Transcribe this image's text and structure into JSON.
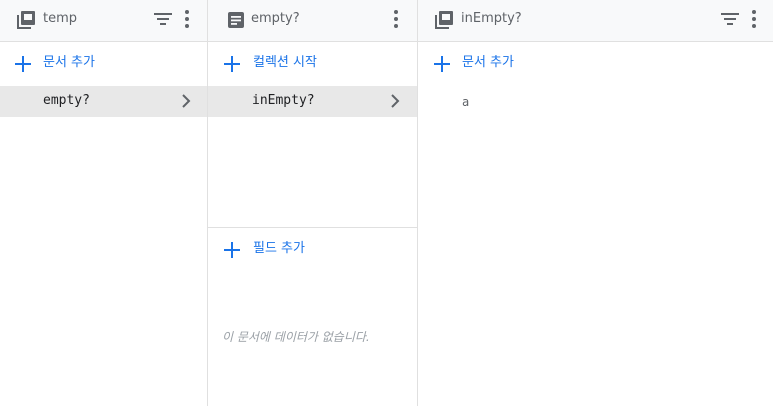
{
  "panels": [
    {
      "header": {
        "title": "temp",
        "icon": "collection-icon"
      },
      "add_label": "문서 추가",
      "items": [
        {
          "label": "empty?"
        }
      ]
    },
    {
      "header": {
        "title": "empty?",
        "icon": "document-icon"
      },
      "add_label": "컬렉션 시작",
      "items": [
        {
          "label": "inEmpty?"
        }
      ],
      "add_field_label": "필드 추가",
      "empty_message": "이 문서에 데이터가 없습니다."
    },
    {
      "header": {
        "title": "inEmpty?",
        "icon": "collection-icon"
      },
      "add_label": "문서 추가",
      "items": [
        {
          "label": "a"
        }
      ]
    }
  ],
  "colors": {
    "accent": "#1a73e8",
    "header_bg": "#f8f9fa",
    "selected_bg": "#e8e8e8",
    "border": "#e0e0e0"
  }
}
